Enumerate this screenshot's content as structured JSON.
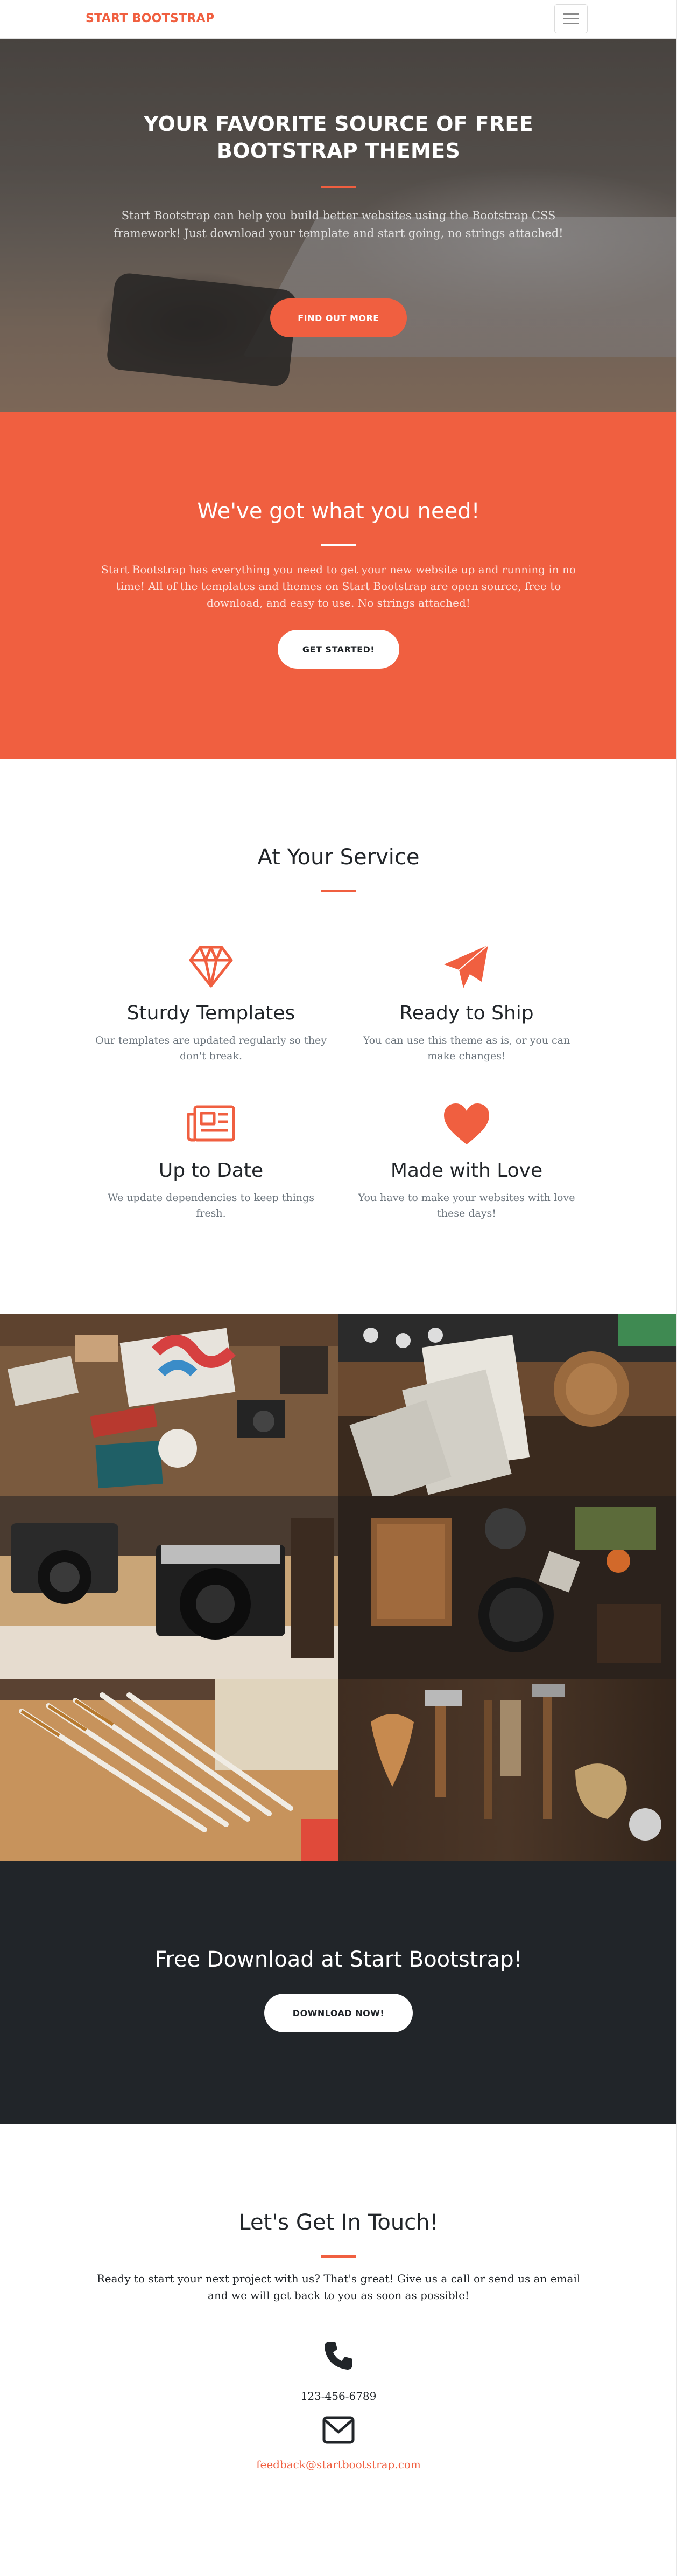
{
  "navbar": {
    "brand": "START BOOTSTRAP",
    "menu_icon": "hamburger-menu-icon"
  },
  "hero": {
    "title_line1": "YOUR FAVORITE SOURCE OF FREE",
    "title_line2": "BOOTSTRAP THEMES",
    "text": "Start Bootstrap can help you build better websites using the Bootstrap CSS framework! Just download your template and start going, no strings attached!",
    "button": "FIND OUT MORE"
  },
  "about": {
    "title": "We've got what you need!",
    "text": "Start Bootstrap has everything you need to get your new website up and running in no time! All of the templates and themes on Start Bootstrap are open source, free to download, and easy to use. No strings attached!",
    "button": "GET STARTED!"
  },
  "services": {
    "title": "At Your Service",
    "items": [
      {
        "icon": "diamond-icon",
        "title": "Sturdy Templates",
        "text": "Our templates are updated regularly so they don't break."
      },
      {
        "icon": "paper-plane-icon",
        "title": "Ready to Ship",
        "text": "You can use this theme as is, or you can make changes!"
      },
      {
        "icon": "newspaper-icon",
        "title": "Up to Date",
        "text": "We update dependencies to keep things fresh."
      },
      {
        "icon": "heart-icon",
        "title": "Made with Love",
        "text": "You have to make your websites with love these days!"
      }
    ]
  },
  "cta": {
    "title": "Free Download at Start Bootstrap!",
    "button": "DOWNLOAD NOW!"
  },
  "contact": {
    "title": "Let's Get In Touch!",
    "text": "Ready to start your next project with us? That's great! Give us a call or send us an email and we will get back to you as soon as possible!",
    "phone": "123-456-6789",
    "email": "feedback@startbootstrap.com",
    "phone_icon": "phone-icon",
    "email_icon": "envelope-icon"
  },
  "colors": {
    "primary": "#f05f40",
    "dark": "#212529",
    "muted": "#6c757d"
  }
}
